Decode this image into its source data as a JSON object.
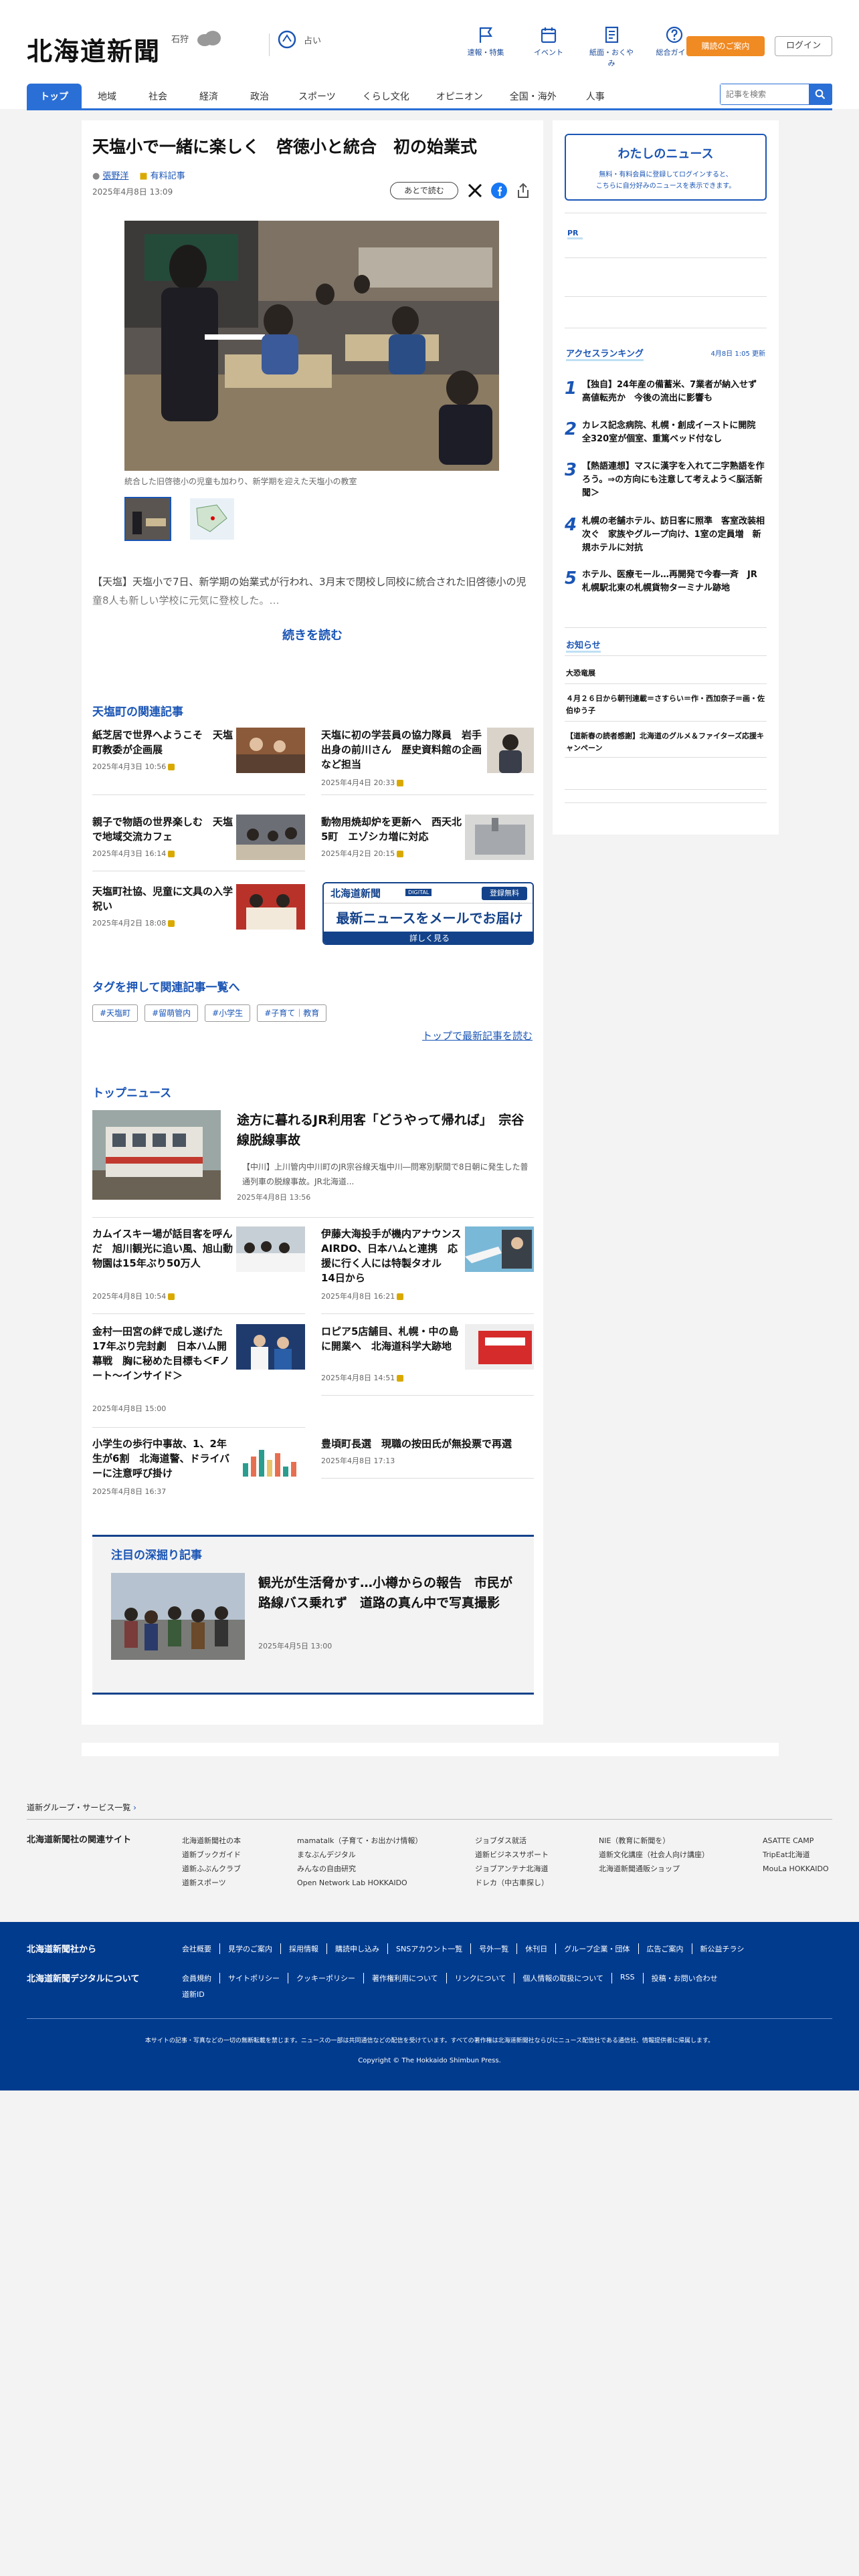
{
  "header": {
    "logo": "北海道新聞",
    "weather_city": "石狩",
    "weather_label": "占い",
    "icons": [
      {
        "name": "flag-icon",
        "label": "速報・特集"
      },
      {
        "name": "calendar-icon",
        "label": "イベント"
      },
      {
        "name": "book-icon",
        "label": "紙面・おくやみ"
      },
      {
        "name": "help-icon",
        "label": "総合ガイド"
      }
    ],
    "register": "購読のご案内",
    "login": "ログイン"
  },
  "nav": {
    "tabs": [
      "トップ",
      "地域",
      "社会",
      "経済",
      "政治",
      "スポーツ",
      "くらし文化",
      "オピニオン",
      "全国・海外",
      "人事"
    ],
    "search_placeholder": "記事を検索"
  },
  "article": {
    "title": "天塩小で一緒に楽しく　啓徳小と統合　初の始業式",
    "author": "張野洋",
    "author_tag": "有料記事",
    "date": "2025年4月8日 13:09",
    "later": "あとで読む",
    "caption": "統合した旧啓徳小の児童も加わり、新学期を迎えた天塩小の教室",
    "lead": "【天塩】天塩小で7日、新学期の始業式が行われ、3月末で閉校し同校に統合された旧啓徳小の児童8人も新しい学校に元気に登校した。…",
    "more": "続きを読む"
  },
  "related": {
    "heading": "天塩町の関連記事",
    "items": [
      {
        "title": "紙芝居で世界へようこそ　天塩町教委が企画展",
        "date": "2025年4月3日 10:56"
      },
      {
        "title": "天塩に初の学芸員の協力隊員　岩手出身の前川さん　歴史資料館の企画など担当",
        "date": "2025年4月4日 20:33"
      },
      {
        "title": "親子で物語の世界楽しむ　天塩で地域交流カフェ",
        "date": "2025年4月3日 16:14"
      },
      {
        "title": "動物用焼却炉を更新へ　西天北5町　エゾシカ増に対応",
        "date": "2025年4月2日 20:15"
      },
      {
        "title": "天塩町社協、児童に文具の入学祝い",
        "date": "2025年4月2日 18:08"
      }
    ],
    "banner": {
      "brand": "北海道新聞",
      "brand_sub": "DIGITAL",
      "badge": "登録無料",
      "headline": "最新ニュースをメールでお届け",
      "cta": "詳しく見る"
    }
  },
  "tags": {
    "heading": "タグを押して関連記事一覧へ",
    "items": [
      "#天塩町",
      "#留萌管内",
      "#小学生",
      "#子育て｜教育"
    ],
    "more": "トップで最新記事を読む"
  },
  "topnews": {
    "heading": "トップニュース",
    "feature": {
      "title": "途方に暮れるJR利用客「どうやって帰れば」　宗谷線脱線事故",
      "summary": "【中川】上川管内中川町のJR宗谷線天塩中川―問寒別駅間で8日朝に発生した普通列車の脱線事故。JR北海道...",
      "date": "2025年4月8日 13:56"
    },
    "items": [
      {
        "title": "カムイスキー場が話目客を呼んだ　旭川観光に追い風、旭山動物園は15年ぶり50万人",
        "date": "2025年4月8日 10:54"
      },
      {
        "title": "伊藤大海投手が機内アナウンス　AIRDO、日本ハムと連携　応援に行く人には特製タオル　14日から",
        "date": "2025年4月8日 16:21"
      },
      {
        "title": "金村一田宮の絆で成し遂げた17年ぶり完封劇　日本ハム開幕戦　胸に秘めた目標も＜Fノート〜インサイド＞",
        "date": "2025年4月8日 15:00"
      },
      {
        "title": "ロピア5店舗目、札幌・中の島に開業へ　北海道科学大跡地",
        "date": "2025年4月8日 14:51"
      },
      {
        "title": "小学生の歩行中事故、1、2年生が6割　北海道警、ドライバーに注意呼び掛け",
        "date": "2025年4月8日 16:37"
      },
      {
        "title": "豊頃町長選　現職の按田氏が無投票で再選",
        "date": "2025年4月8日 17:13"
      }
    ]
  },
  "deep": {
    "heading": "注目の深掘り記事",
    "title": "観光が生活脅かす…小樽からの報告　市民が路線バス乗れず　道路の真ん中で写真撮影",
    "date": "2025年4月5日 13:00"
  },
  "sidebar": {
    "my_title": "わたしのニュース",
    "my_text1": "無料・有料会員に登録してログインすると、",
    "my_text2": "こちらに自分好みのニュースを表示できます。",
    "pr": "PR",
    "ranking_heading": "アクセスランキング",
    "ranking_date": "4月8日 1:05 更新",
    "ranking": [
      {
        "n": "1",
        "title": "【独自】24年産の備蓄米、7業者が納入せず高値転売か　今後の流出に影響も"
      },
      {
        "n": "2",
        "title": "カレス記念病院、札幌・創成イーストに開院　全320室が個室、重篤ベッド付なし"
      },
      {
        "n": "3",
        "title": "【熱語連想】マスに漢字を入れて二字熟語を作ろう。⇒の方向にも注意して考えよう＜脳活新聞＞"
      },
      {
        "n": "4",
        "title": "札幌の老舗ホテル、訪日客に照準　客室改装相次ぐ　家族やグループ向け、1室の定員増　新規ホテルに対抗"
      },
      {
        "n": "5",
        "title": "ホテル、医療モール…再開発で今春一斉　JR札幌駅北東の札幌貨物ターミナル跡地"
      }
    ],
    "notice_heading": "お知らせ",
    "notice_sub": "大恐竜展",
    "notices": [
      "４月２６日から朝刊連載＝さすらい＝作・西加奈子＝画・佐伯ゆう子",
      "【道新春の読者感謝】北海道のグルメ＆ファイターズ応援キャンペーン"
    ]
  },
  "footer": {
    "group_link": "道新グループ・サービス一覧",
    "related_heading": "北海道新聞社の関連サイト",
    "cols": [
      [
        "北海道新聞社の本",
        "道新ブックガイド",
        "道新ふぶんクラブ",
        "道新スポーツ"
      ],
      [
        "mamatalk（子育て・お出かけ情報）",
        "まなぶんデジタル",
        "みんなの自由研究",
        "Open Network Lab HOKKAIDO"
      ],
      [
        "ジョブダス就活",
        "道新ビジネスサポート",
        "ジョブアンテナ北海道",
        "ドレカ（中古車探し）"
      ],
      [
        "NIE（教育に新聞を）",
        "道新文化講座（社会人向け講座）",
        "北海道新聞通販ショップ"
      ],
      [
        "ASATTE CAMP",
        "TripEat北海道",
        "MouLa HOKKAIDO"
      ]
    ],
    "from_heading": "北海道新聞社から",
    "digital_heading": "北海道新聞デジタルについて",
    "links1": [
      "会社概要",
      "見学のご案内",
      "採用情報",
      "購読申し込み",
      "SNSアカウント一覧",
      "号外一覧",
      "休刊日",
      "グループ企業・団体",
      "広告ご案内",
      "新公益チラシ"
    ],
    "links2": [
      "会員規約",
      "サイトポリシー",
      "クッキーポリシー",
      "著作権利用について",
      "リンクについて",
      "個人情報の取扱について",
      "RSS",
      "投稿・お問い合わせ",
      "道新ID"
    ],
    "notice": "本サイトの記事・写真などの一切の無断転載を禁じます。ニュースの一部は共同通信などの配信を受けています。すべての著作権は北海道新聞社ならびにニュース配信社である通信社、情報提供者に帰属します。",
    "copyright": "Copyright © The Hokkaido Shimbun Press."
  },
  "colors": {
    "primary": "#2a6fd6",
    "dark_blue": "#013b8e",
    "orange": "#f08a23"
  }
}
